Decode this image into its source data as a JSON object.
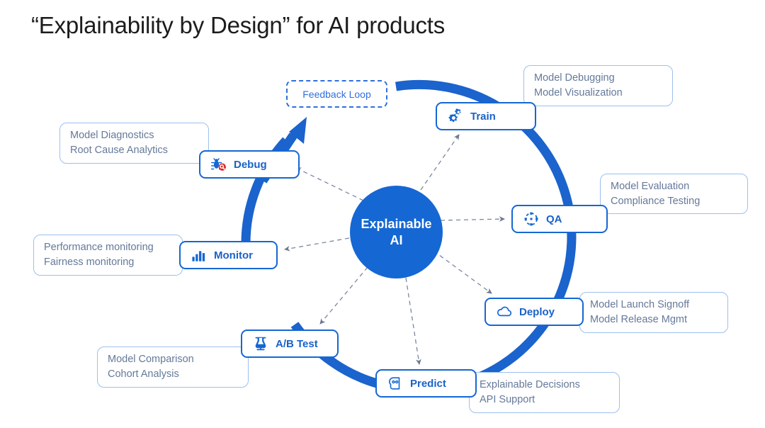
{
  "page": {
    "title": "“Explainability by Design” for AI products",
    "background_color": "#ffffff"
  },
  "colors": {
    "ring_blue": "#1b63cd",
    "node_border": "#1567d3",
    "node_label": "#1a62c8",
    "hub_fill": "#1567d3",
    "hub_text": "#ffffff",
    "callout_border": "#9cc0ee",
    "callout_text": "#65799a",
    "dashed_connector": "#7b879c",
    "feedback_border": "#2f6fdd",
    "debug_accent_red": "#e02b2b"
  },
  "hub": {
    "line1": "Explainable",
    "line2": "AI"
  },
  "feedback_loop": {
    "label": "Feedback Loop",
    "style": "dashed"
  },
  "nodes": [
    {
      "id": "train",
      "label": "Train",
      "icon": "gears-icon",
      "callout": [
        "Model Debugging",
        "Model Visualization"
      ]
    },
    {
      "id": "qa",
      "label": "QA",
      "icon": "selection-target-icon",
      "callout": [
        "Model Evaluation",
        "Compliance Testing"
      ]
    },
    {
      "id": "deploy",
      "label": "Deploy",
      "icon": "cloud-icon",
      "callout": [
        "Model Launch Signoff",
        "Model Release Mgmt"
      ]
    },
    {
      "id": "predict",
      "label": "Predict",
      "icon": "head-brain-icon",
      "callout": [
        "Explainable Decisions",
        "API  Support"
      ]
    },
    {
      "id": "abtest",
      "label": "A/B Test",
      "icon": "flask-icon",
      "callout": [
        "Model Comparison",
        "Cohort Analysis"
      ]
    },
    {
      "id": "monitor",
      "label": "Monitor",
      "icon": "bar-chart-icon",
      "callout": [
        "Performance monitoring",
        "Fairness monitoring"
      ]
    },
    {
      "id": "debug",
      "label": "Debug",
      "icon": "bug-magnifier-icon",
      "callout": [
        "Model Diagnostics",
        "Root Cause Analytics"
      ]
    }
  ],
  "callouts": {
    "train": {
      "line1": "Model Debugging",
      "line2": "Model Visualization"
    },
    "qa": {
      "line1": "Model Evaluation",
      "line2": "Compliance Testing"
    },
    "deploy": {
      "line1": "Model Launch Signoff",
      "line2": "Model Release Mgmt"
    },
    "predict": {
      "line1": "Explainable Decisions",
      "line2": "API  Support"
    },
    "abtest": {
      "line1": "Model Comparison",
      "line2": "Cohort Analysis"
    },
    "monitor": {
      "line1": "Performance monitoring",
      "line2": "Fairness monitoring"
    },
    "debug": {
      "line1": "Model Diagnostics",
      "line2": "Root Cause Analytics"
    }
  },
  "lifecycle_order": [
    "Train",
    "QA",
    "Deploy",
    "Predict",
    "A/B Test",
    "Monitor",
    "Debug",
    "Feedback Loop"
  ]
}
